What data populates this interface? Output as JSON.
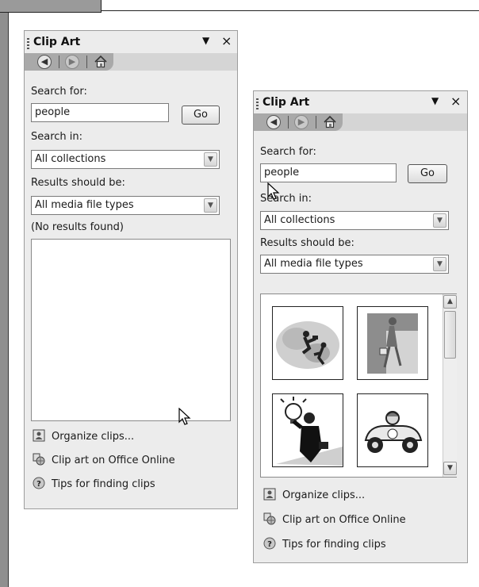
{
  "panel_left": {
    "title": "Clip Art",
    "menu_glyph": "▼",
    "close_glyph": "×",
    "nav": {
      "back_glyph": "◀",
      "forward_glyph": "▶"
    },
    "search_label": "Search for:",
    "search_value": "people",
    "go_label": "Go",
    "search_in_label": "Search in:",
    "search_in_value": "All collections",
    "results_label": "Results should be:",
    "results_value": "All media file types",
    "status_text": "(No results found)",
    "links": [
      "Organize clips...",
      "Clip art on Office Online",
      "Tips for finding clips"
    ]
  },
  "panel_right": {
    "title": "Clip Art",
    "menu_glyph": "▼",
    "close_glyph": "×",
    "nav": {
      "back_glyph": "◀",
      "forward_glyph": "▶"
    },
    "search_label": "Search for:",
    "search_value": "people",
    "go_label": "Go",
    "search_in_label": "Search in:",
    "search_in_value": "All collections",
    "results_label": "Results should be:",
    "results_value": "All media file types",
    "clips": [
      "business-people-clip",
      "walking-woman-clip",
      "lightbulb-idea-clip",
      "race-car-clip"
    ],
    "links": [
      "Organize clips...",
      "Clip art on Office Online",
      "Tips for finding clips"
    ]
  },
  "icons": {
    "organize": "organize-clips-icon",
    "online": "office-online-icon",
    "tips": "help-icon",
    "dropdown": "chevron-down-icon"
  },
  "colors": {
    "panel_bg": "#ececec",
    "nav_bg": "#a9a9a9",
    "frame_gray": "#8f8f8f"
  }
}
